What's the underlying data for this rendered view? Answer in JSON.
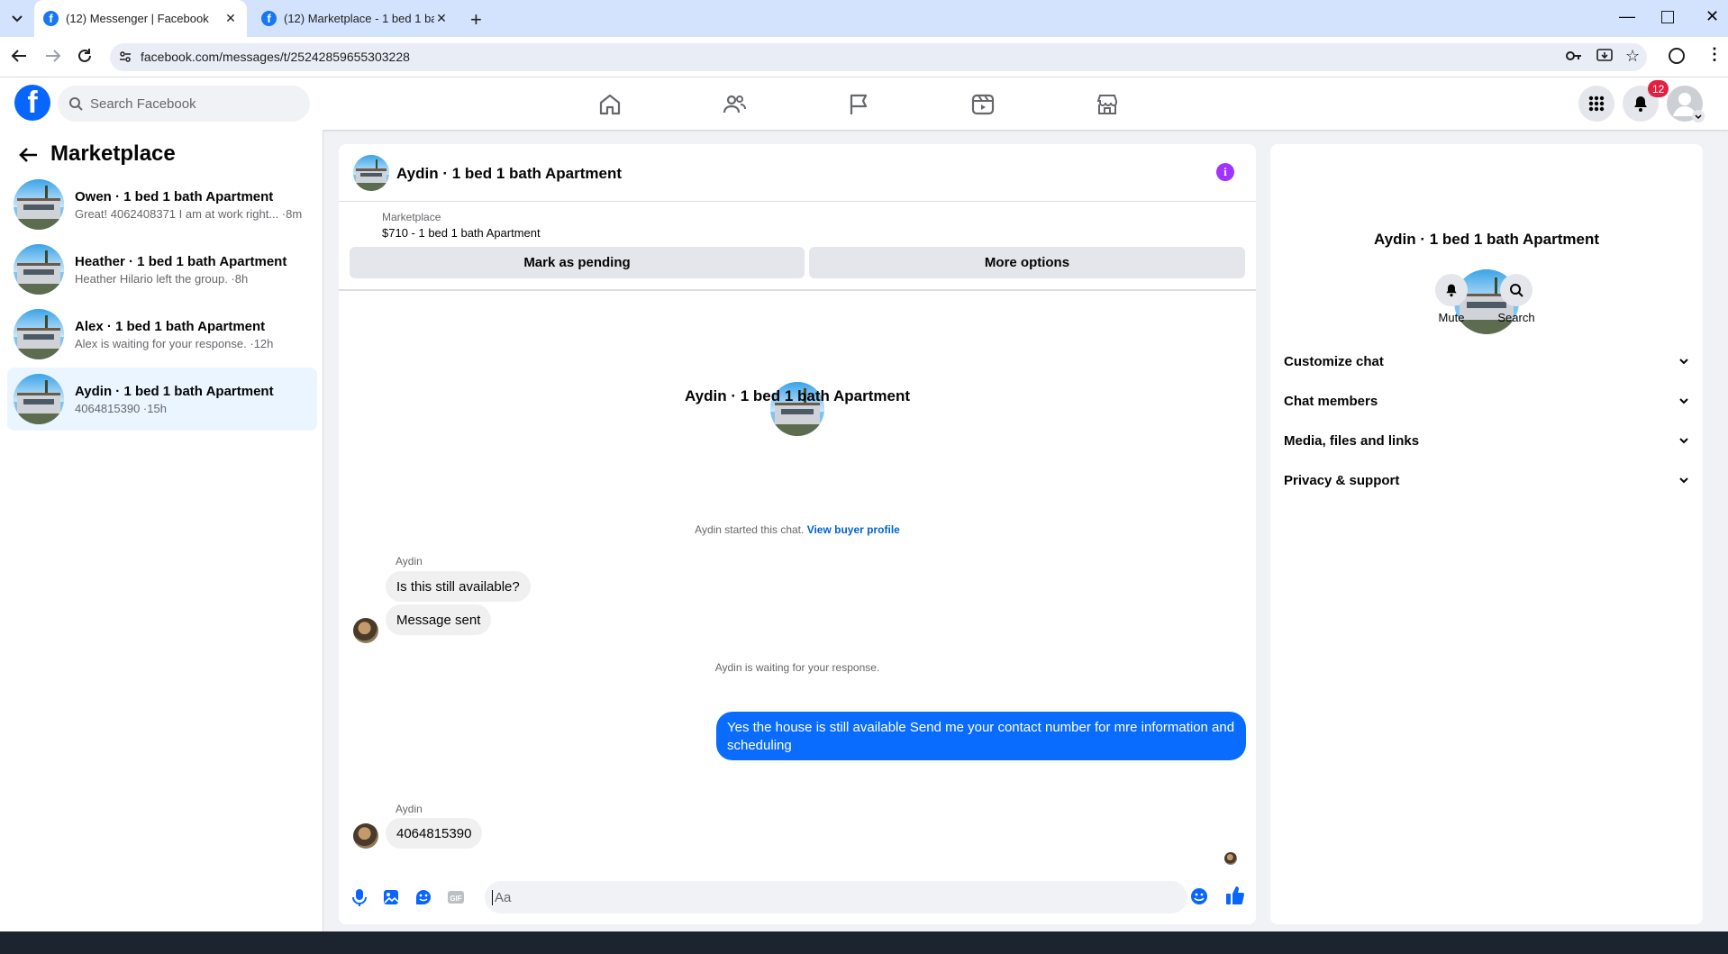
{
  "browser": {
    "tabs": [
      {
        "title": "(12) Messenger | Facebook",
        "active": true
      },
      {
        "title": "(12) Marketplace - 1 bed 1 bath",
        "active": false
      }
    ],
    "url": "facebook.com/messages/t/25242859655303228"
  },
  "header": {
    "search_placeholder": "Search Facebook",
    "notification_count": "12",
    "nav": [
      "home-icon",
      "friends-icon",
      "pages-flag-icon",
      "video-icon",
      "marketplace-icon"
    ]
  },
  "sidebar": {
    "title": "Marketplace",
    "conversations": [
      {
        "name": "Owen · 1 bed 1 bath Apartment",
        "preview": "Great! 4062408371 I am at work right... ·8m",
        "selected": false
      },
      {
        "name": "Heather · 1 bed 1 bath Apartment",
        "preview": "Heather Hilario left the group. ·8h",
        "selected": false
      },
      {
        "name": "Alex · 1 bed 1 bath Apartment",
        "preview": "Alex is waiting for your response. ·12h",
        "selected": false
      },
      {
        "name": "Aydin · 1 bed 1 bath Apartment",
        "preview": "4064815390 ·15h",
        "selected": true
      }
    ]
  },
  "chat": {
    "title": "Aydin · 1 bed 1 bath Apartment",
    "listing_source": "Marketplace",
    "listing_price": "$710 - 1 bed 1 bath Apartment",
    "mark_pending_label": "Mark as pending",
    "more_options_label": "More options",
    "center_name": "Aydin · 1 bed 1 bath Apartment",
    "started_text": "Aydin started this chat.",
    "view_profile_label": "View buyer profile",
    "sender_name": "Aydin",
    "msg1": "Is this still available?",
    "msg2": "Message sent",
    "waiting_text": "Aydin is waiting for your response.",
    "outgoing": "Yes the house is still available  Send me your contact number for mre information and  scheduling",
    "sender_name_2": "Aydin",
    "msg3": "4064815390",
    "input_placeholder": "Aa"
  },
  "details": {
    "name": "Aydin · 1 bed 1 bath Apartment",
    "mute_label": "Mute",
    "search_label": "Search",
    "sections": [
      "Customize chat",
      "Chat members",
      "Media, files and links",
      "Privacy & support"
    ]
  },
  "colors": {
    "brand": "#0866ff",
    "outgoing_bubble": "#0a6cff",
    "info": "#a033ff",
    "badge": "#e41e3f"
  }
}
